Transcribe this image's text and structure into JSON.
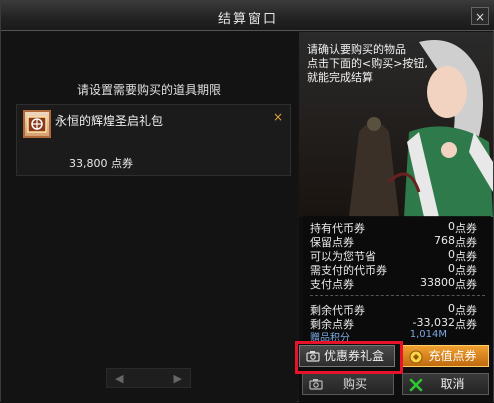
{
  "window": {
    "title": "结算窗口",
    "close_glyph": "×"
  },
  "instruction": "请设置需要购买的道具期限",
  "item": {
    "name": "永恒的辉煌圣启礼包",
    "price": "33,800 点券",
    "remove_glyph": "×",
    "icon": "gift-pack-icon"
  },
  "npc_message": [
    "请确认要购买的物品",
    "点击下面的<购买>按钮,",
    "就能完成结算"
  ],
  "summary": {
    "rows": [
      {
        "label": "持有代币券",
        "value": "0",
        "unit": "点券"
      },
      {
        "label": "保留点券",
        "value": "768",
        "unit": "点券"
      },
      {
        "label": "可以为您节省",
        "value": "0",
        "unit": "点券"
      },
      {
        "label": "需支付的代币券",
        "value": "0",
        "unit": "点券"
      },
      {
        "label": "支付点券",
        "value": "33800",
        "unit": "点券"
      }
    ],
    "remaining": [
      {
        "label": "剩余代币券",
        "value": "0",
        "unit": "点券"
      },
      {
        "label": "剩余点券",
        "value": "-33,032",
        "unit": "点券"
      }
    ],
    "partial_label": "赠品积分",
    "partial_value": "1,014M"
  },
  "buttons": {
    "coupon": "优惠券礼盒",
    "charge": "充值点券",
    "buy": "购买",
    "cancel": "取消"
  },
  "pager": {
    "prev": "◀",
    "next": "▶"
  },
  "colors": {
    "highlight": "#e8132b",
    "charge_button": "#e08a20",
    "cancel_icon": "#2ec830"
  }
}
